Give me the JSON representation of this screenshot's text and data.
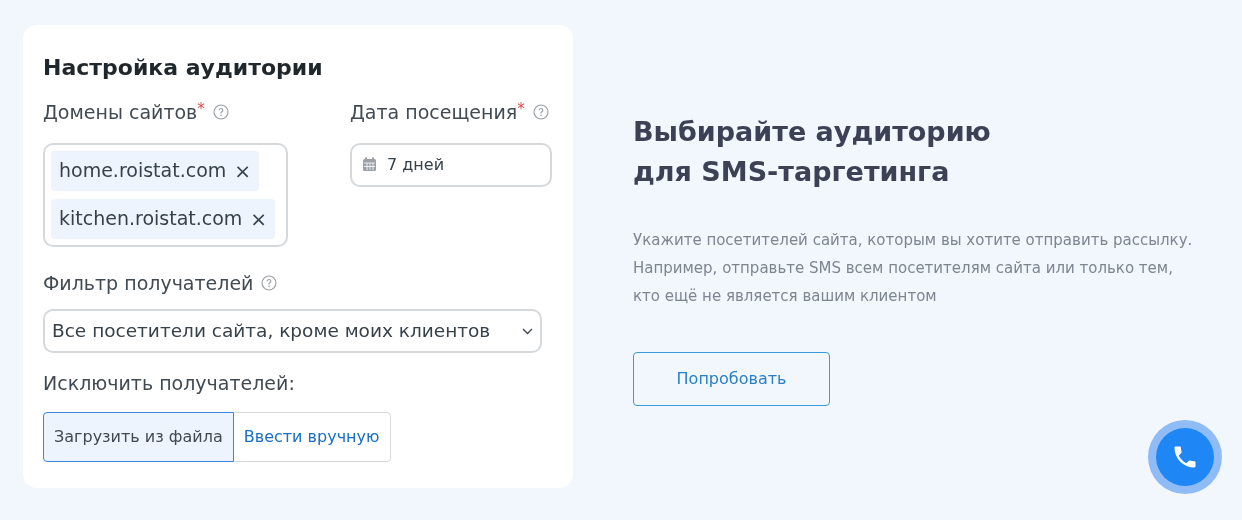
{
  "card": {
    "title": "Настройка аудитории",
    "domains": {
      "label": "Домены сайтов",
      "required_mark": "*",
      "tags": [
        {
          "text": "home.roistat.com",
          "remove": "×"
        },
        {
          "text": "kitchen.roistat.com",
          "remove": "×"
        }
      ]
    },
    "visit_date": {
      "label": "Дата посещения",
      "required_mark": "*",
      "value": "7 дней"
    },
    "recipient_filter": {
      "label": "Фильтр получателей",
      "value": "Все посетители сайта, кроме моих клиентов"
    },
    "exclude": {
      "label": "Исключить получателей:",
      "options": [
        {
          "label": "Загрузить из файла",
          "selected": true
        },
        {
          "label": "Ввести вручную",
          "selected": false
        }
      ]
    }
  },
  "promo": {
    "heading": [
      "Выбирайте аудиторию",
      "для SMS-таргетинга"
    ],
    "description": "Укажите посетителей сайта, которым вы хотите отправить рассылку. Например, отправьте SMS всем посетителям сайта или только тем, кто ещё не является вашим клиентом",
    "button": "Попробовать"
  }
}
